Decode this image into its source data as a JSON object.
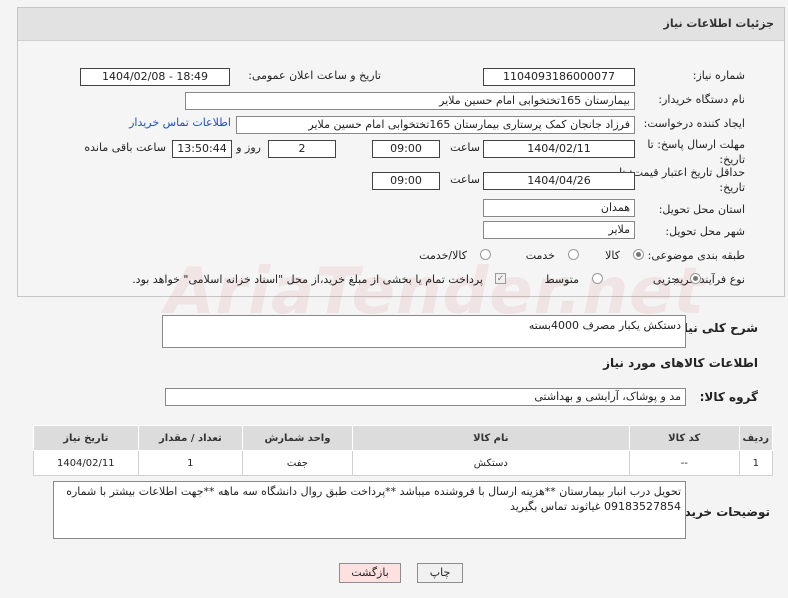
{
  "header": {
    "title": "جزئیات اطلاعات نیاز"
  },
  "form": {
    "need_number_label": "شماره نیاز:",
    "need_number": "1104093186000077",
    "announce_label": "تاریخ و ساعت اعلان عمومی:",
    "announce_value": "1404/02/08 - 18:49",
    "buyer_label": "نام دستگاه خریدار:",
    "buyer_value": "بیمارستان 165تختخوابی امام حسین ملایر",
    "creator_label": "ایجاد کننده درخواست:",
    "creator_value": "فرزاد جانجان کمک پرستاری بیمارستان 165تختخوابی امام حسین ملایر",
    "contact_link": "اطلاعات تماس خریدار",
    "deadline_label": "مهلت ارسال پاسخ: تا تاریخ:",
    "deadline_date": "1404/02/11",
    "time_label": "ساعت",
    "deadline_time": "09:00",
    "days_value": "2",
    "days_label": "روز و",
    "remaining_time": "13:50:44",
    "remaining_label": "ساعت باقی مانده",
    "validity_label": "حداقل تاریخ اعتبار قیمت: تا تاریخ:",
    "validity_date": "1404/04/26",
    "validity_time": "09:00",
    "province_label": "استان محل تحویل:",
    "province_value": "همدان",
    "city_label": "شهر محل تحویل:",
    "city_value": "ملایر",
    "category_label": "طبقه بندی موضوعی:",
    "category_options": [
      "کالا",
      "خدمت",
      "کالا/خدمت"
    ],
    "category_selected": "کالا",
    "process_label": "نوع فرآیند خرید :",
    "process_options": [
      "جزیی",
      "متوسط"
    ],
    "process_selected": "جزیی",
    "payment_note": "پرداخت تمام یا بخشی از مبلغ خرید،از محل \"اسناد خزانه اسلامی\" خواهد بود."
  },
  "description": {
    "label": "شرح کلی نیاز:",
    "value": "دستکش یکبار مصرف 4000بسته"
  },
  "goods_section": {
    "title": "اطلاعات کالاهای مورد نیاز",
    "group_label": "گروه کالا:",
    "group_value": "مد و پوشاک، آرایشی و بهداشتی",
    "columns": [
      "ردیف",
      "کد کالا",
      "نام کالا",
      "واحد شمارش",
      "تعداد / مقدار",
      "تاریخ نیاز"
    ],
    "rows": [
      [
        "1",
        "--",
        "دستکش",
        "جفت",
        "1",
        "1404/02/11"
      ]
    ]
  },
  "buyer_notes": {
    "label": "توضیحات خریدار:",
    "value": "تحویل درب انبار بیمارستان **هزینه ارسال با فروشنده میباشد **پرداخت طبق روال دانشگاه سه ماهه **جهت اطلاعات بیشتر  با شماره 09183527854 غیاثوند تماس بگیرید"
  },
  "buttons": {
    "print": "چاپ",
    "back": "بازگشت"
  },
  "watermark": "AriaTender.net",
  "colors": {
    "link": "#1a52c8",
    "back_button": "#fde1e1",
    "header": "#e2e2e2"
  }
}
